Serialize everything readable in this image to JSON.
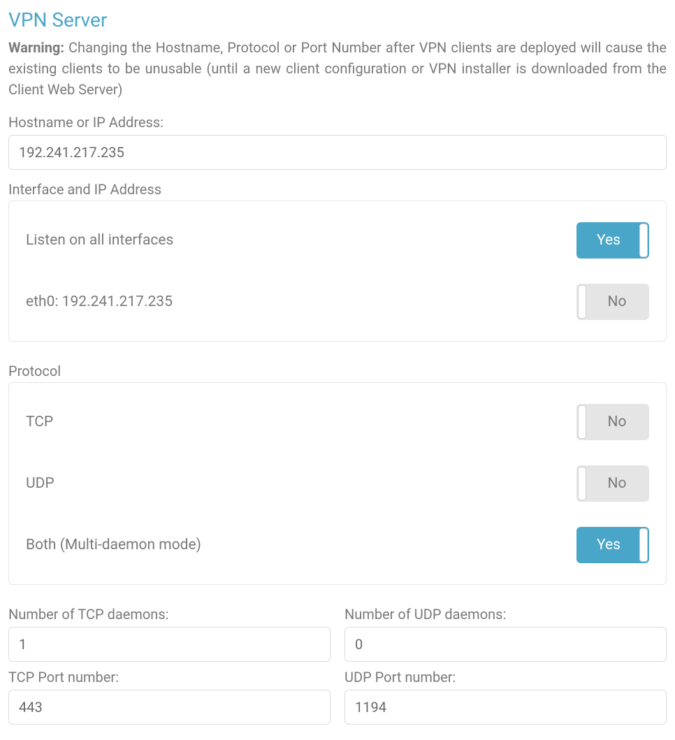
{
  "title": "VPN Server",
  "warning": {
    "prefix": "Warning:",
    "body": " Changing the Hostname, Protocol or Port Number after VPN clients are deployed will cause the existing clients to be unusable (until a new client configuration or VPN installer is downloaded from the Client Web Server)"
  },
  "hostname": {
    "label": "Hostname or IP Address:",
    "value": "192.241.217.235"
  },
  "interface_section": {
    "label": "Interface and IP Address",
    "options": [
      {
        "label": "Listen on all interfaces",
        "state": "Yes"
      },
      {
        "label": "eth0: 192.241.217.235",
        "state": "No"
      }
    ]
  },
  "protocol_section": {
    "label": "Protocol",
    "options": [
      {
        "label": "TCP",
        "state": "No"
      },
      {
        "label": "UDP",
        "state": "No"
      },
      {
        "label": "Both (Multi-daemon mode)",
        "state": "Yes"
      }
    ]
  },
  "daemons": {
    "tcp_count_label": "Number of TCP daemons:",
    "tcp_count_value": "1",
    "udp_count_label": "Number of UDP daemons:",
    "udp_count_value": "0",
    "tcp_port_label": "TCP Port number:",
    "tcp_port_value": "443",
    "udp_port_label": "UDP Port number:",
    "udp_port_value": "1194"
  },
  "toggle_labels": {
    "yes": "Yes",
    "no": "No"
  }
}
